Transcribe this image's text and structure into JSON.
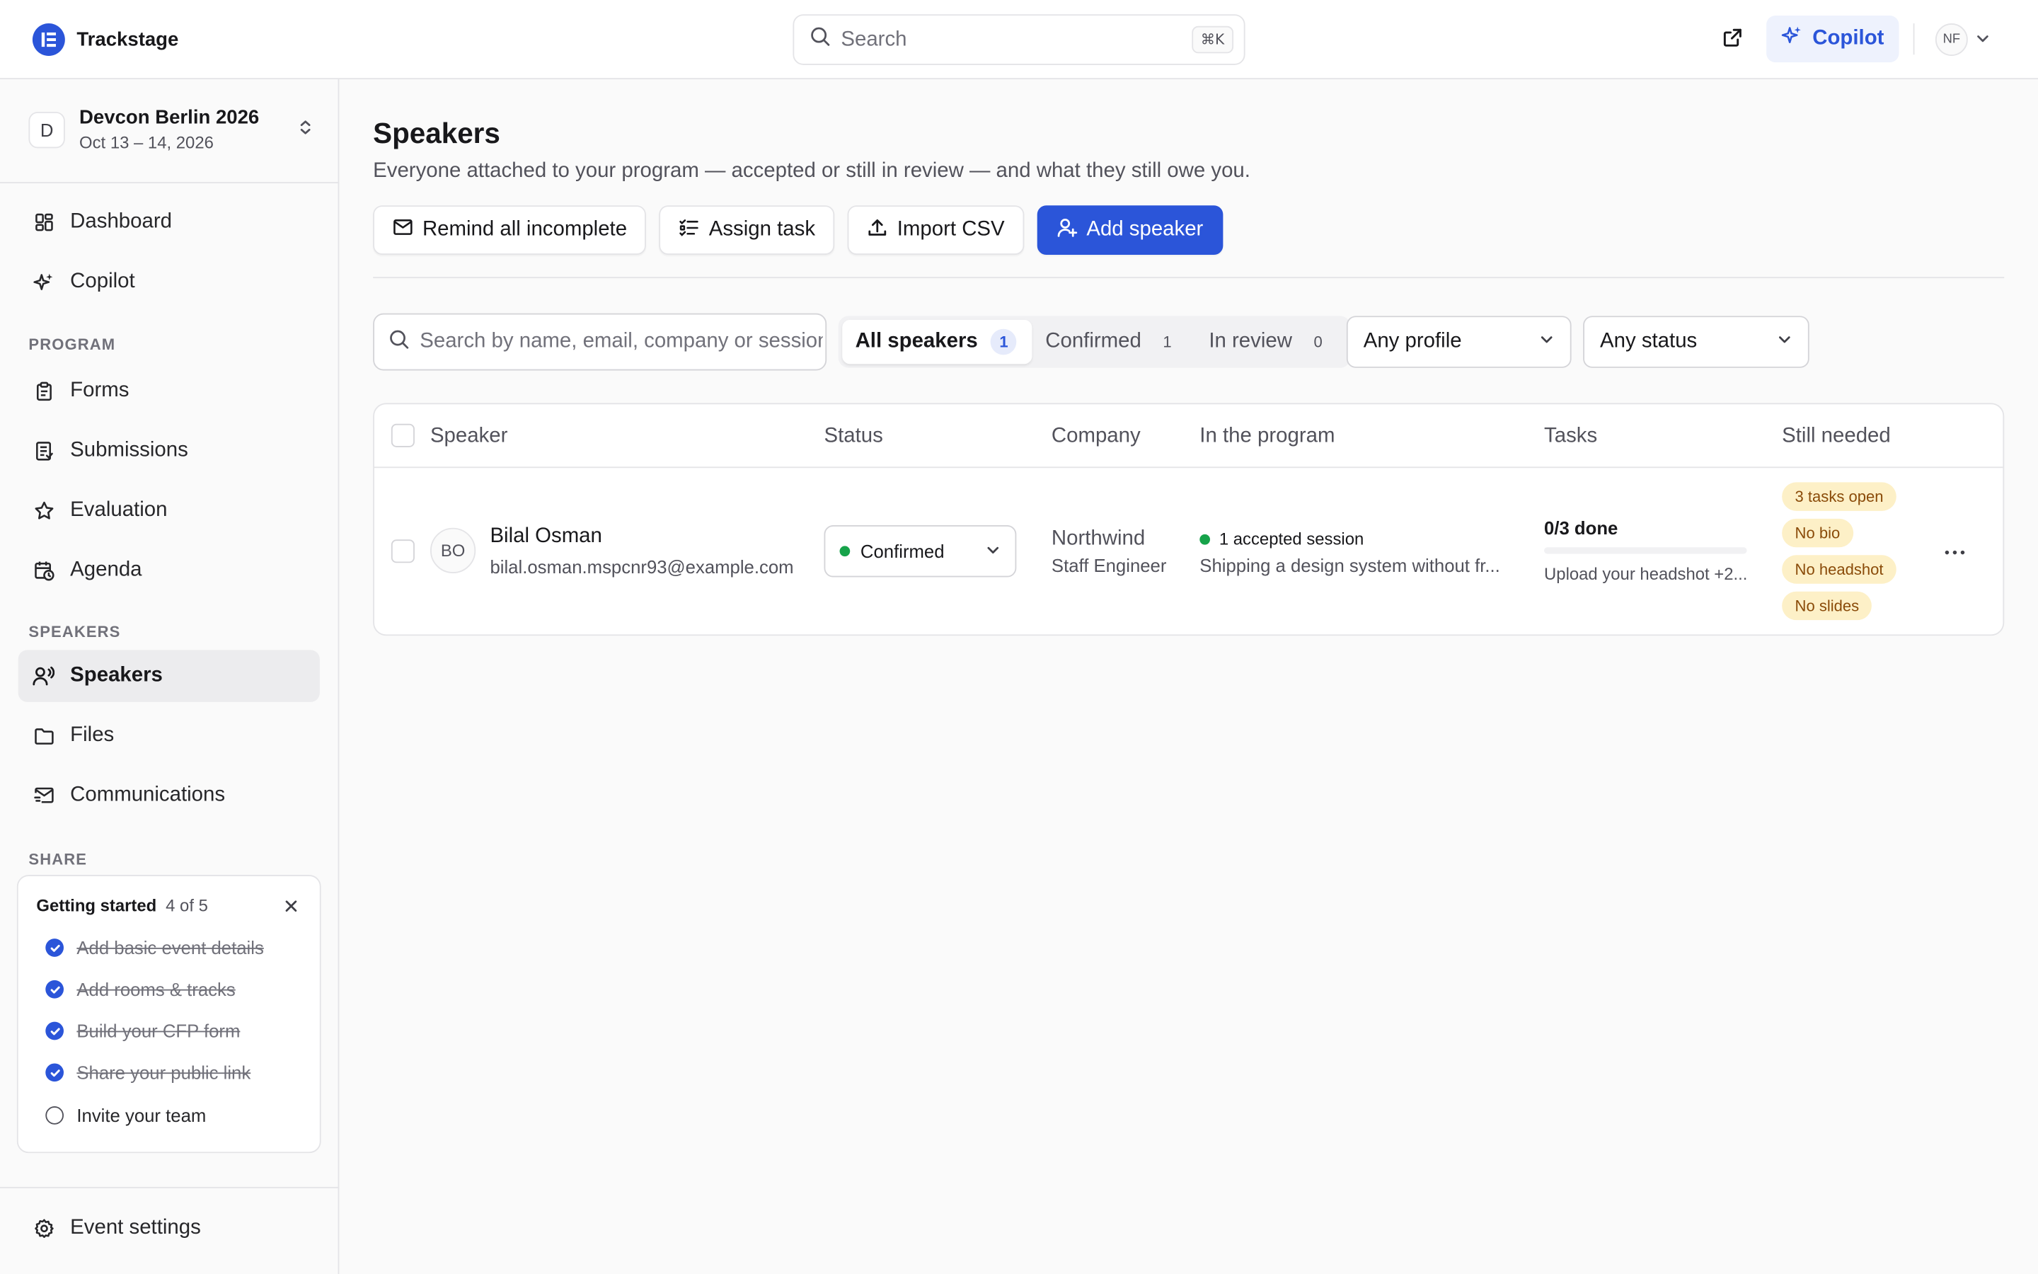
{
  "app": {
    "name": "Trackstage"
  },
  "topbar": {
    "search_placeholder": "Search",
    "search_shortcut": "⌘K",
    "copilot_label": "Copilot",
    "user_initials": "NF"
  },
  "event": {
    "avatar_letter": "D",
    "name": "Devcon Berlin 2026",
    "dates": "Oct 13 – 14, 2026"
  },
  "sidebar": {
    "top_items": [
      {
        "label": "Dashboard",
        "icon": "dashboard-icon"
      },
      {
        "label": "Copilot",
        "icon": "sparkle-icon"
      }
    ],
    "program_label": "PROGRAM",
    "program_items": [
      {
        "label": "Forms",
        "icon": "clipboard-icon"
      },
      {
        "label": "Submissions",
        "icon": "document-list-icon"
      },
      {
        "label": "Evaluation",
        "icon": "star-icon"
      },
      {
        "label": "Agenda",
        "icon": "calendar-clock-icon"
      }
    ],
    "speakers_label": "SPEAKERS",
    "speakers_items": [
      {
        "label": "Speakers",
        "icon": "speaker-icon",
        "active": true
      },
      {
        "label": "Files",
        "icon": "folder-icon"
      },
      {
        "label": "Communications",
        "icon": "mail-icon"
      }
    ],
    "share_label": "SHARE",
    "getting_started": {
      "title": "Getting started",
      "count": "4 of 5",
      "items": [
        {
          "label": "Add basic event details",
          "done": true
        },
        {
          "label": "Add rooms & tracks",
          "done": true
        },
        {
          "label": "Build your CFP form",
          "done": true
        },
        {
          "label": "Share your public link",
          "done": true
        },
        {
          "label": "Invite your team",
          "done": false
        }
      ]
    },
    "settings_label": "Event settings"
  },
  "main": {
    "title": "Speakers",
    "subtitle": "Everyone attached to your program — accepted or still in review — and what they still owe you.",
    "actions": {
      "remind": "Remind all incomplete",
      "assign": "Assign task",
      "import": "Import CSV",
      "add": "Add speaker"
    },
    "filters": {
      "search_placeholder": "Search by name, email, company or session",
      "tabs": [
        {
          "label": "All speakers",
          "count": "1",
          "active": true
        },
        {
          "label": "Confirmed",
          "count": "1",
          "active": false
        },
        {
          "label": "In review",
          "count": "0",
          "active": false
        }
      ],
      "profile_select": "Any profile",
      "status_select": "Any status"
    },
    "table": {
      "columns": [
        "Speaker",
        "Status",
        "Company",
        "In the program",
        "Tasks",
        "Still needed"
      ],
      "rows": [
        {
          "initials": "BO",
          "name": "Bilal Osman",
          "email": "bilal.osman.mspcnr93@example.com",
          "status": "Confirmed",
          "company": "Northwind",
          "role": "Staff Engineer",
          "program_summary": "1 accepted session",
          "program_detail": "Shipping a design system without fr...",
          "tasks_done": "0/3 done",
          "tasks_progress": 0,
          "tasks_next": "Upload your headshot +2...",
          "still_needed": [
            "3 tasks open",
            "No bio",
            "No headshot",
            "No slides"
          ]
        }
      ]
    }
  },
  "colors": {
    "accent": "#2b55d9",
    "status_confirmed": "#16a34a",
    "badge_bg": "#fdf0c7",
    "badge_text": "#8a4b09"
  }
}
